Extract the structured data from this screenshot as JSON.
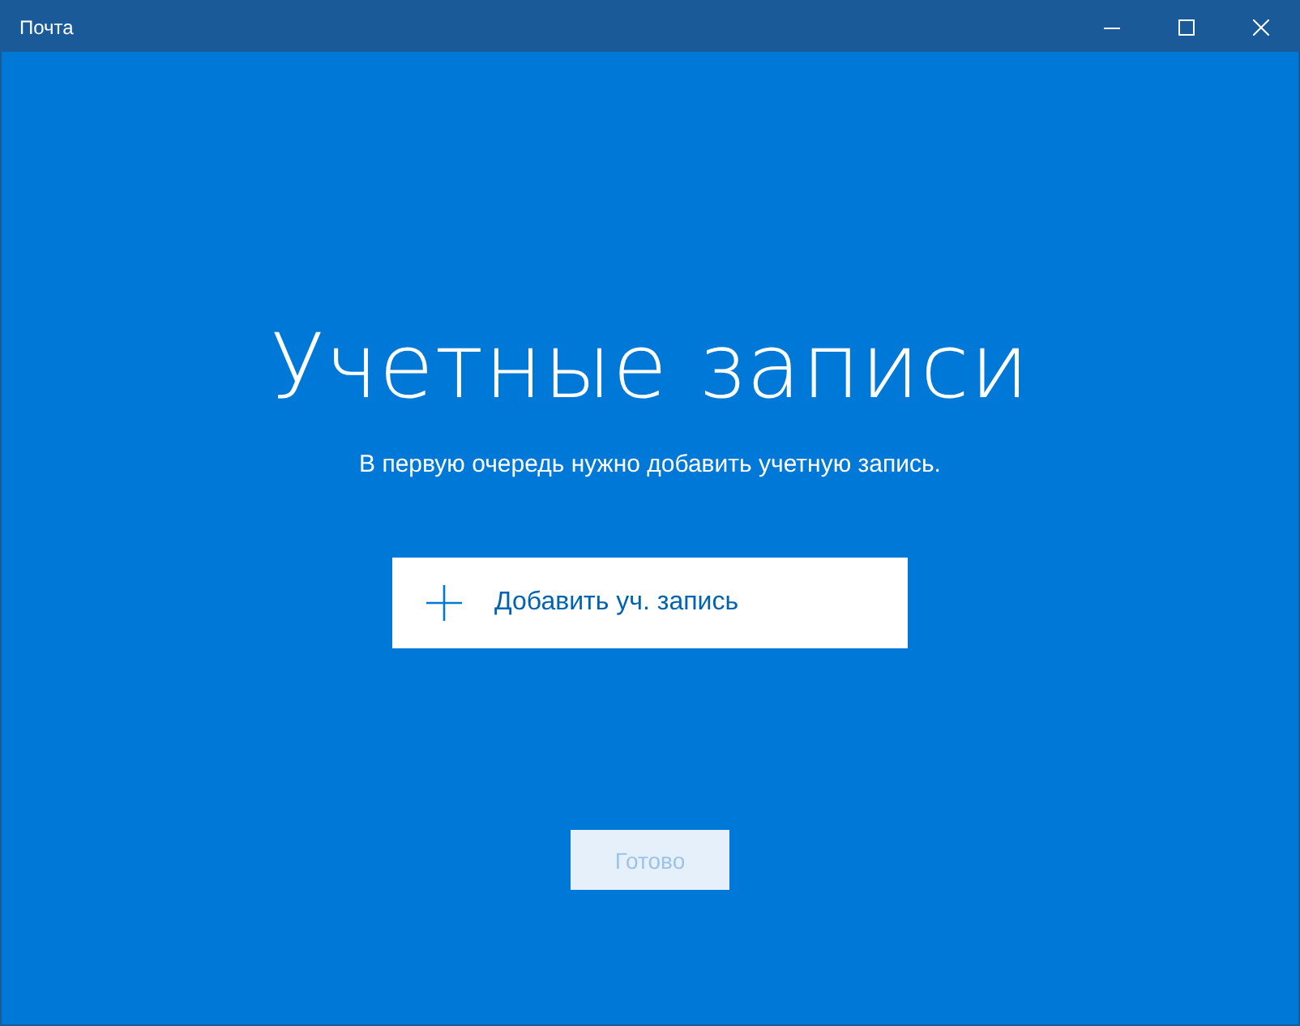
{
  "window": {
    "title": "Почта"
  },
  "heading": "Учетные записи",
  "subtitle": "В первую очередь нужно добавить учетную запись.",
  "add_account_button": {
    "label": "Добавить уч. запись"
  },
  "done_button": {
    "label": "Готово",
    "disabled": true
  }
}
